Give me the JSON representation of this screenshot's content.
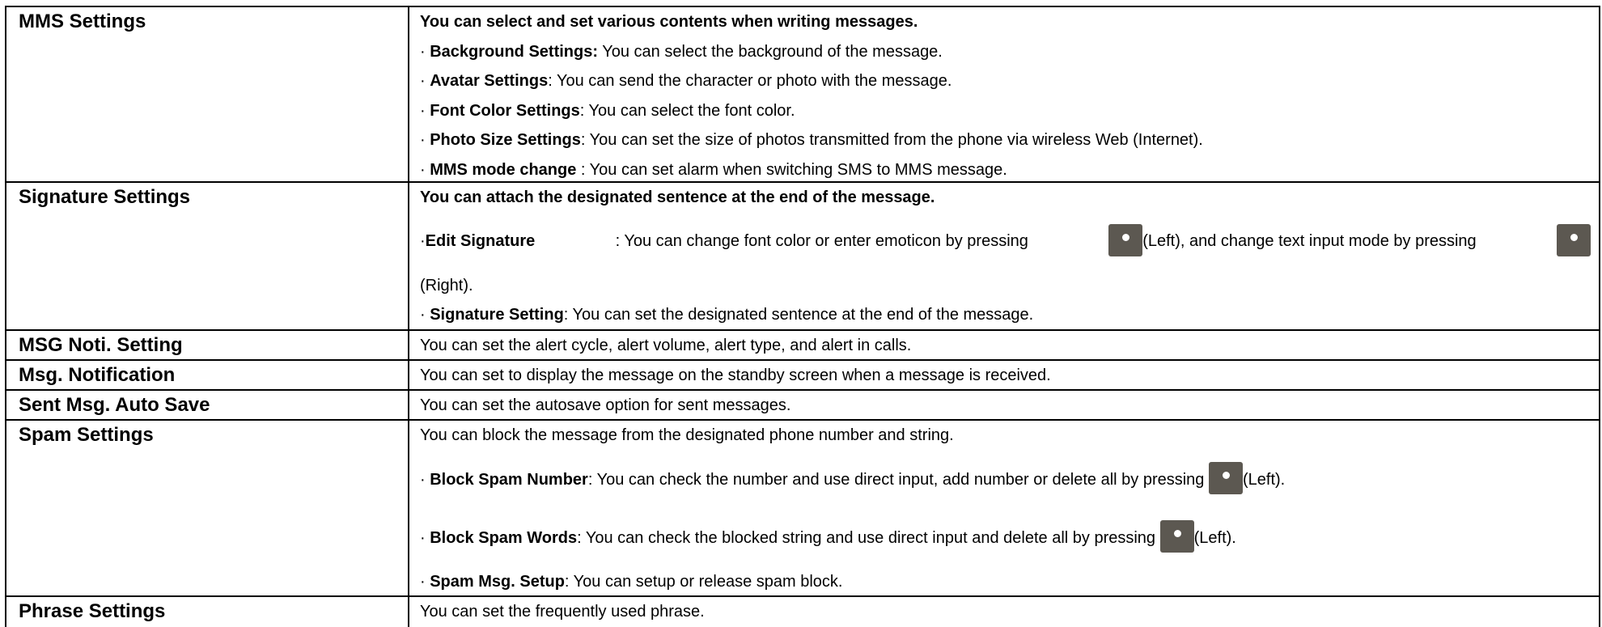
{
  "rows": [
    {
      "label": "MMS Settings",
      "lines": [
        {
          "bold": "You can select and set various contents when writing messages.",
          "text": ""
        },
        {
          "prefix": "· ",
          "bold": "Background Settings:",
          "text": " You can select the background of the message."
        },
        {
          "prefix": "· ",
          "bold": "Avatar Settings",
          "text": ": You can send the character or photo with the message."
        },
        {
          "prefix": "· ",
          "bold": "Font Color Settings",
          "text": ": You can select the font color."
        },
        {
          "prefix": "· ",
          "bold": "Photo Size Settings",
          "text": ": You can set the size of photos transmitted from the phone via wireless Web (Internet)."
        },
        {
          "prefix": "· ",
          "bold": "MMS mode change",
          "text": " : You can set alarm when switching SMS to MMS message."
        }
      ]
    },
    {
      "label": "Signature Settings",
      "lines": [
        {
          "bold": "You can attach the designated sentence at the end of the message."
        },
        {
          "prefix": "· ",
          "bold": "Edit Signature",
          "text_a": ": You can change font color or enter emoticon by pressing",
          "after_icon": "(Left), and change text input mode by pressing",
          "wrap": "(Right)."
        },
        {
          "prefix": "· ",
          "bold": "Signature Setting",
          "text": ": You can set the designated sentence at the end of the message."
        }
      ]
    },
    {
      "label": "MSG Noti. Setting",
      "text": "You can set the alert cycle, alert volume, alert type, and alert in calls."
    },
    {
      "label": "Msg. Notification",
      "text": "You can set to display the message on the standby screen when a message is received."
    },
    {
      "label": "Sent Msg. Auto Save",
      "text": "You can set the autosave option for sent messages."
    },
    {
      "label": "Spam Settings",
      "lines": [
        {
          "text": "You can block the message from the designated phone number and string."
        },
        {
          "prefix": "· ",
          "bold": "Block Spam Number",
          "text": ": You can check the number and use direct input, add number or delete all by pressing",
          "after_icon": "(Left)."
        },
        {
          "prefix": "· ",
          "bold": "Block Spam Words",
          "text": ": You can check the blocked string and use direct input and delete all by pressing",
          "after_icon": "(Left)."
        },
        {
          "prefix": "· ",
          "bold": "Spam Msg. Setup",
          "text": ": You can setup or release spam block."
        }
      ]
    },
    {
      "label": "Phrase Settings",
      "text": "You can set the frequently used phrase."
    }
  ],
  "icons": {
    "button": "center-key-icon",
    "color": "#5c5851"
  }
}
